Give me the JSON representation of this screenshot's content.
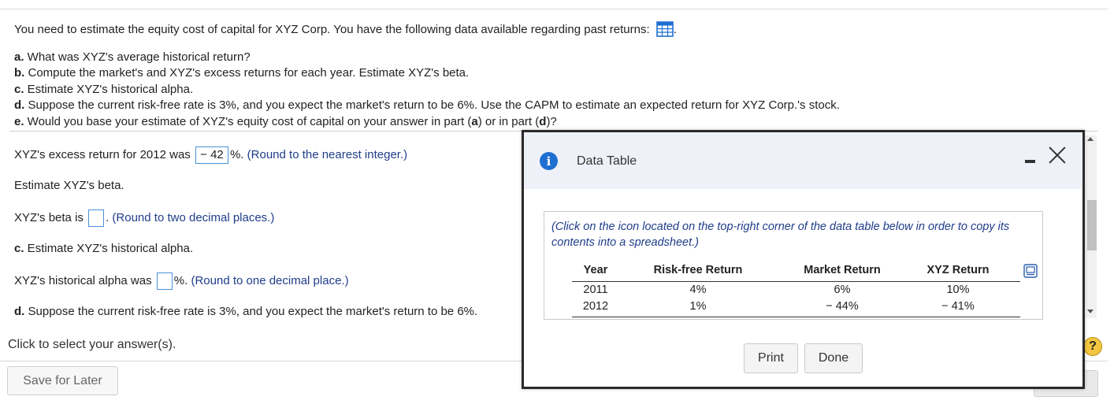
{
  "question": {
    "intro": "You need to estimate the equity cost of capital for XYZ Corp. You have the following data available regarding past returns:",
    "intro_end": ".",
    "parts": [
      {
        "letter": "a.",
        "text": " What was XYZ's average historical return?"
      },
      {
        "letter": "b.",
        "text": " Compute the market's and XYZ's excess returns for each year. Estimate XYZ's beta."
      },
      {
        "letter": "c.",
        "text": " Estimate XYZ's historical alpha."
      },
      {
        "letter": "d.",
        "text": " Suppose the current risk-free rate is 3%, and you expect the market's return to be 6%. Use the CAPM to estimate an expected return for XYZ Corp.'s stock."
      }
    ],
    "part_e": {
      "letter": "e.",
      "pre": " Would you base your estimate of XYZ's equity cost of capital on your answer in part (",
      "a": "a",
      "mid": ") or in part (",
      "d": "d",
      "post": ")?"
    }
  },
  "answers": {
    "excess_prefix": "XYZ's excess return for 2012 was",
    "excess_value": "− 42",
    "excess_suffix": "%.",
    "excess_hint": "(Round to the nearest integer.)",
    "beta_heading": "Estimate XYZ's beta.",
    "beta_prefix": "XYZ's beta is",
    "beta_value": "",
    "beta_suffix": ".",
    "beta_hint": "(Round to two decimal places.)",
    "alpha_heading_letter": "c.",
    "alpha_heading_text": " Estimate XYZ's historical alpha.",
    "alpha_prefix": "XYZ's historical alpha was",
    "alpha_value": "",
    "alpha_suffix": "%.",
    "alpha_hint": "(Round to one decimal place.)",
    "d_letter": "d.",
    "d_text": " Suppose the current risk-free rate is 3%, and you expect the market's return to be 6%."
  },
  "footer": {
    "click_msg": "Click to select your answer(s).",
    "save_label": "Save for Later",
    "help_label": "?"
  },
  "modal": {
    "title": "Data Table",
    "info_glyph": "i",
    "note": "(Click on the icon located on the top-right corner of the data table below in order to copy its contents into a spreadsheet.)",
    "columns": [
      "Year",
      "Risk-free Return",
      "Market Return",
      "XYZ Return"
    ],
    "rows": [
      [
        "2011",
        "4%",
        "6%",
        "10%"
      ],
      [
        "2012",
        "1%",
        "− 44%",
        "− 41%"
      ]
    ],
    "print_label": "Print",
    "done_label": "Done"
  },
  "colors": {
    "accent_blue": "#1f6fd1",
    "hint_blue": "#1f3d8a",
    "header_bg": "#eef2f8",
    "help_yellow": "#f3c640"
  }
}
